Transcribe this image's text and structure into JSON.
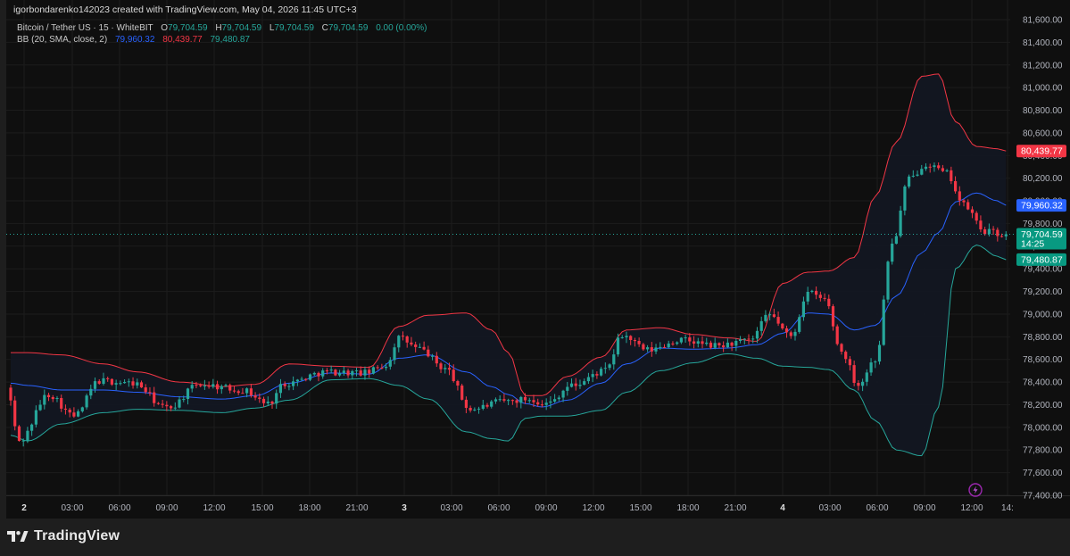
{
  "header": {
    "creator_line": "igorbondarenko142023 created with TradingView.com, May 04, 2026 11:45 UTC+3"
  },
  "legend": {
    "symbol": "Bitcoin / Tether US · 15 · WhiteBIT",
    "o_label": "O",
    "o_value": "79,704.59",
    "h_label": "H",
    "h_value": "79,704.59",
    "l_label": "L",
    "l_value": "79,704.59",
    "c_label": "C",
    "c_value": "79,704.59",
    "change": "0.00 (0.00%)",
    "bb_label": "BB (20, SMA, close, 2)",
    "bb_basis": "79,960.32",
    "bb_upper": "80,439.77",
    "bb_lower": "79,480.87"
  },
  "price_tags": {
    "upper": "80,439.77",
    "basis": "79,960.32",
    "last": "79,704.59",
    "countdown": "14:25",
    "lower": "79,480.87"
  },
  "branding": {
    "logo_text": "TradingView"
  },
  "colors": {
    "background": "#0f0f0f",
    "up_candle": "#26a69a",
    "down_candle": "#f23645",
    "bb_basis": "#2962ff",
    "bb_upper": "#f23645",
    "bb_lower": "#26a69a",
    "bb_fill": "#131722"
  },
  "icons": {
    "lightning": "lightning-icon",
    "logo": "tradingview-logo-icon"
  },
  "chart_data": {
    "type": "candlestick",
    "title": "Bitcoin / Tether US · 15 · WhiteBIT",
    "y_axis": {
      "min": 77400,
      "max": 81600,
      "position": "right",
      "ticks": [
        "81,600.00",
        "81,400.00",
        "81,200.00",
        "81,000.00",
        "80,800.00",
        "80,600.00",
        "80,400.00",
        "80,200.00",
        "80,000.00",
        "79,800.00",
        "79,600.00",
        "79,400.00",
        "79,200.00",
        "79,000.00",
        "78,800.00",
        "78,600.00",
        "78,400.00",
        "78,200.00",
        "78,000.00",
        "77,800.00",
        "77,600.00",
        "77,400.00"
      ]
    },
    "x_axis": {
      "ticks": [
        "2",
        "03:00",
        "06:00",
        "09:00",
        "12:00",
        "15:00",
        "18:00",
        "21:00",
        "3",
        "03:00",
        "06:00",
        "09:00",
        "12:00",
        "15:00",
        "18:00",
        "21:00",
        "4",
        "03:00",
        "06:00",
        "09:00",
        "12:00",
        "14:"
      ],
      "bold_ticks": [
        "2",
        "3",
        "4"
      ]
    },
    "grid": true,
    "last_price": 79704.59,
    "bollinger_keypoints": [
      {
        "t": 0,
        "upper": 78660,
        "basis": 78390,
        "lower": 77930
      },
      {
        "t": 4,
        "upper": 78660,
        "basis": 78370,
        "lower": 77880
      },
      {
        "t": 12,
        "upper": 78640,
        "basis": 78330,
        "lower": 78030
      },
      {
        "t": 22,
        "upper": 78560,
        "basis": 78330,
        "lower": 78130
      },
      {
        "t": 30,
        "upper": 78490,
        "basis": 78310,
        "lower": 78160
      },
      {
        "t": 40,
        "upper": 78400,
        "basis": 78270,
        "lower": 78150
      },
      {
        "t": 50,
        "upper": 78360,
        "basis": 78250,
        "lower": 78130
      },
      {
        "t": 58,
        "upper": 78380,
        "basis": 78280,
        "lower": 78170
      },
      {
        "t": 66,
        "upper": 78560,
        "basis": 78390,
        "lower": 78240
      },
      {
        "t": 76,
        "upper": 78540,
        "basis": 78480,
        "lower": 78420
      },
      {
        "t": 85,
        "upper": 78530,
        "basis": 78470,
        "lower": 78430
      },
      {
        "t": 92,
        "upper": 78890,
        "basis": 78610,
        "lower": 78370
      },
      {
        "t": 99,
        "upper": 78990,
        "basis": 78640,
        "lower": 78250
      },
      {
        "t": 108,
        "upper": 79010,
        "basis": 78490,
        "lower": 77960
      },
      {
        "t": 114,
        "upper": 78860,
        "basis": 78360,
        "lower": 77900
      },
      {
        "t": 118,
        "upper": 78660,
        "basis": 78290,
        "lower": 77880
      },
      {
        "t": 122,
        "upper": 78280,
        "basis": 78210,
        "lower": 78080
      },
      {
        "t": 126,
        "upper": 78280,
        "basis": 78180,
        "lower": 78100
      },
      {
        "t": 132,
        "upper": 78450,
        "basis": 78240,
        "lower": 78100
      },
      {
        "t": 140,
        "upper": 78620,
        "basis": 78390,
        "lower": 78150
      },
      {
        "t": 146,
        "upper": 78860,
        "basis": 78560,
        "lower": 78310
      },
      {
        "t": 154,
        "upper": 78880,
        "basis": 78700,
        "lower": 78500
      },
      {
        "t": 162,
        "upper": 78820,
        "basis": 78690,
        "lower": 78570
      },
      {
        "t": 170,
        "upper": 78790,
        "basis": 78700,
        "lower": 78650
      },
      {
        "t": 177,
        "upper": 78760,
        "basis": 78730,
        "lower": 78610
      },
      {
        "t": 183,
        "upper": 79270,
        "basis": 78830,
        "lower": 78540
      },
      {
        "t": 189,
        "upper": 79370,
        "basis": 79010,
        "lower": 78530
      },
      {
        "t": 194,
        "upper": 79380,
        "basis": 79000,
        "lower": 78510
      },
      {
        "t": 200,
        "upper": 79500,
        "basis": 78860,
        "lower": 78330
      },
      {
        "t": 205,
        "upper": 80040,
        "basis": 78900,
        "lower": 78060
      },
      {
        "t": 210,
        "upper": 80520,
        "basis": 79160,
        "lower": 77800
      },
      {
        "t": 216,
        "upper": 81100,
        "basis": 79540,
        "lower": 77750
      },
      {
        "t": 220,
        "upper": 81120,
        "basis": 79720,
        "lower": 78180
      },
      {
        "t": 224,
        "upper": 80700,
        "basis": 79990,
        "lower": 79400
      },
      {
        "t": 229,
        "upper": 80480,
        "basis": 80070,
        "lower": 79610
      },
      {
        "t": 234,
        "upper": 80460,
        "basis": 80000,
        "lower": 79510
      },
      {
        "t": 236,
        "upper": 80440,
        "basis": 79960,
        "lower": 79480
      }
    ],
    "price_keypoints": [
      {
        "t": 0,
        "p": 78350
      },
      {
        "t": 3,
        "p": 77880
      },
      {
        "t": 10,
        "p": 78290
      },
      {
        "t": 16,
        "p": 78100
      },
      {
        "t": 22,
        "p": 78410
      },
      {
        "t": 30,
        "p": 78390
      },
      {
        "t": 38,
        "p": 78170
      },
      {
        "t": 46,
        "p": 78380
      },
      {
        "t": 56,
        "p": 78330
      },
      {
        "t": 62,
        "p": 78210
      },
      {
        "t": 66,
        "p": 78390
      },
      {
        "t": 76,
        "p": 78490
      },
      {
        "t": 85,
        "p": 78480
      },
      {
        "t": 90,
        "p": 78550
      },
      {
        "t": 93,
        "p": 78790
      },
      {
        "t": 98,
        "p": 78690
      },
      {
        "t": 104,
        "p": 78520
      },
      {
        "t": 110,
        "p": 78160
      },
      {
        "t": 118,
        "p": 78230
      },
      {
        "t": 124,
        "p": 78250
      },
      {
        "t": 128,
        "p": 78210
      },
      {
        "t": 134,
        "p": 78370
      },
      {
        "t": 142,
        "p": 78500
      },
      {
        "t": 146,
        "p": 78810
      },
      {
        "t": 152,
        "p": 78680
      },
      {
        "t": 160,
        "p": 78770
      },
      {
        "t": 168,
        "p": 78720
      },
      {
        "t": 176,
        "p": 78760
      },
      {
        "t": 181,
        "p": 78990
      },
      {
        "t": 186,
        "p": 78800
      },
      {
        "t": 190,
        "p": 79190
      },
      {
        "t": 194,
        "p": 79130
      },
      {
        "t": 198,
        "p": 78670
      },
      {
        "t": 202,
        "p": 78380
      },
      {
        "t": 206,
        "p": 78600
      },
      {
        "t": 210,
        "p": 79620
      },
      {
        "t": 214,
        "p": 80190
      },
      {
        "t": 218,
        "p": 80330
      },
      {
        "t": 223,
        "p": 80240
      },
      {
        "t": 227,
        "p": 79960
      },
      {
        "t": 232,
        "p": 79730
      },
      {
        "t": 236,
        "p": 79705
      }
    ]
  }
}
